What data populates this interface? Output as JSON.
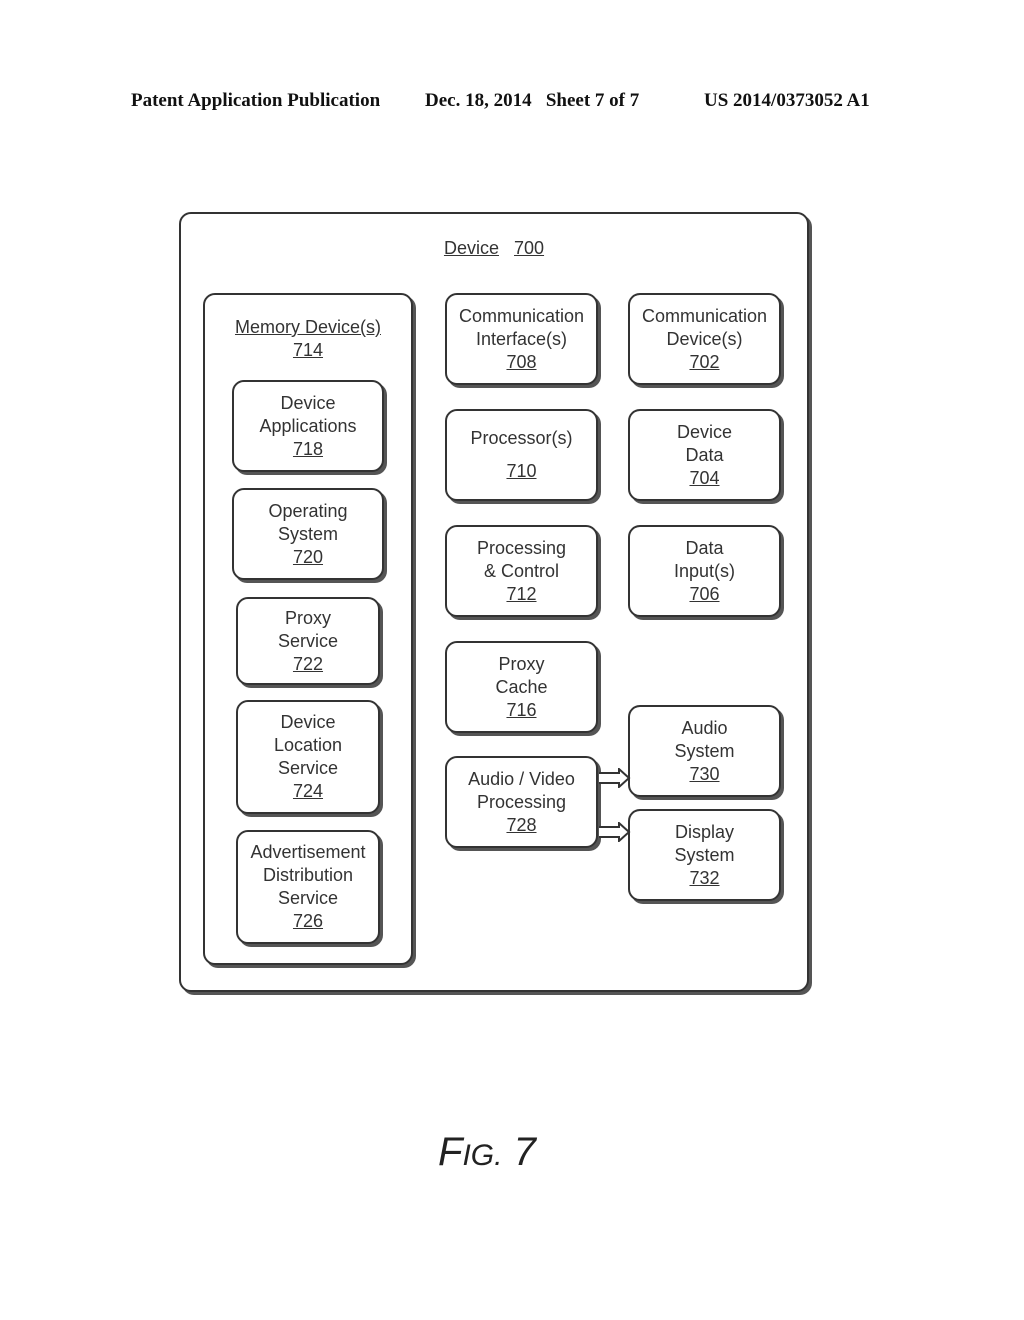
{
  "header": {
    "publication": "Patent Application Publication",
    "date_sheet": "Dec. 18, 2014   Sheet 7 of 7",
    "patent_number": "US 2014/0373052 A1"
  },
  "device": {
    "label": "Device",
    "number": "700"
  },
  "memory": {
    "label": "Memory Device(s)",
    "number": "714",
    "items": [
      {
        "lines": [
          "Device",
          "Applications"
        ],
        "number": "718"
      },
      {
        "lines": [
          "Operating",
          "System"
        ],
        "number": "720"
      },
      {
        "lines": [
          "Proxy",
          "Service"
        ],
        "number": "722"
      },
      {
        "lines": [
          "Device",
          "Location",
          "Service"
        ],
        "number": "724"
      },
      {
        "lines": [
          "Advertisement",
          "Distribution",
          "Service"
        ],
        "number": "726"
      }
    ]
  },
  "middle": [
    {
      "lines": [
        "Communication",
        "Interface(s)"
      ],
      "number": "708"
    },
    {
      "lines": [
        "Processor(s)"
      ],
      "number": "710"
    },
    {
      "lines": [
        "Processing",
        "& Control"
      ],
      "number": "712"
    },
    {
      "lines": [
        "Proxy",
        "Cache"
      ],
      "number": "716"
    },
    {
      "lines": [
        "Audio / Video",
        "Processing"
      ],
      "number": "728"
    }
  ],
  "right": [
    {
      "lines": [
        "Communication",
        "Device(s)"
      ],
      "number": "702"
    },
    {
      "lines": [
        "Device",
        "Data"
      ],
      "number": "704"
    },
    {
      "lines": [
        "Data",
        "Input(s)"
      ],
      "number": "706"
    },
    {
      "lines": [
        "Audio",
        "System"
      ],
      "number": "730"
    },
    {
      "lines": [
        "Display",
        "System"
      ],
      "number": "732"
    }
  ],
  "figure": {
    "prefix": "F",
    "rest": "IG.",
    "number": "7"
  }
}
